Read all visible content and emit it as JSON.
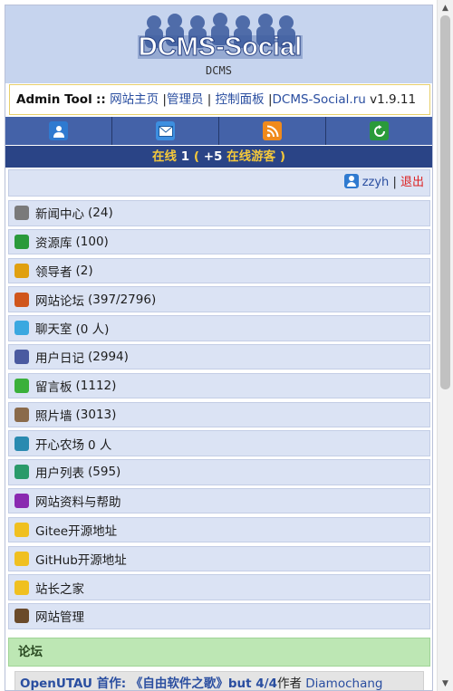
{
  "header": {
    "logo_text": "DCMS-Social",
    "caption": "DCMS"
  },
  "admin_bar": {
    "title": "Admin Tool",
    "separator": "::",
    "links": [
      "网站主页",
      "管理员",
      "控制面板",
      "DCMS-Social.ru"
    ],
    "version": "v1.9.11"
  },
  "toolbar": {
    "icons": [
      "user-icon",
      "mail-icon",
      "rss-icon",
      "refresh-icon"
    ],
    "colors": {
      "user": "#2f7ad0",
      "mail": "#3d8fe0",
      "rss": "#f08a1c",
      "refresh": "#2a9a3a"
    }
  },
  "online": {
    "label": "在线",
    "count": "1",
    "open": "(",
    "guests": "+5",
    "guests_label": "在线游客",
    "close": ")"
  },
  "user": {
    "name": "zzyh",
    "separator": "|",
    "logout": "退出"
  },
  "menu": [
    {
      "label": "新闻中心",
      "count": "(24)",
      "icon": "news-icon",
      "color": "#7a7a7a"
    },
    {
      "label": "资源库",
      "count": "(100)",
      "icon": "refresh-icon",
      "color": "#2a9a3a"
    },
    {
      "label": "领导者",
      "count": "(2)",
      "icon": "trophy-icon",
      "color": "#e0a010"
    },
    {
      "label": "网站论坛",
      "count": "(397/2796)",
      "icon": "pencil-icon",
      "color": "#d0561c"
    },
    {
      "label": "聊天室",
      "count": "(0 人)",
      "icon": "chat-icon",
      "color": "#3aa8e0"
    },
    {
      "label": "用户日记",
      "count": "(2994)",
      "icon": "diary-icon",
      "color": "#4a5aa0"
    },
    {
      "label": "留言板",
      "count": "(1112)",
      "icon": "note-icon",
      "color": "#3ab03a"
    },
    {
      "label": "照片墙",
      "count": "(3013)",
      "icon": "photo-icon",
      "color": "#8a6a4a"
    },
    {
      "label": "开心农场",
      "count": "0 人",
      "icon": "farm-icon",
      "color": "#2a8ab0"
    },
    {
      "label": "用户列表",
      "count": "(595)",
      "icon": "users-icon",
      "color": "#2a9a6a"
    },
    {
      "label": "网站资料与帮助",
      "count": "",
      "icon": "help-icon",
      "color": "#8a2ab0"
    },
    {
      "label": "Gitee开源地址",
      "count": "",
      "icon": "folder-icon",
      "color": "#f0c020"
    },
    {
      "label": "GitHub开源地址",
      "count": "",
      "icon": "folder-icon",
      "color": "#f0c020"
    },
    {
      "label": "站长之家",
      "count": "",
      "icon": "folder-icon",
      "color": "#f0c020"
    },
    {
      "label": "网站管理",
      "count": "",
      "icon": "admin-icon",
      "color": "#6a4a2a"
    }
  ],
  "forum": {
    "heading": "论坛",
    "post_title": "OpenUTAU 首作: 《自由软件之歌》but 4/4",
    "author_label": "作者",
    "author": "Diamochang"
  }
}
